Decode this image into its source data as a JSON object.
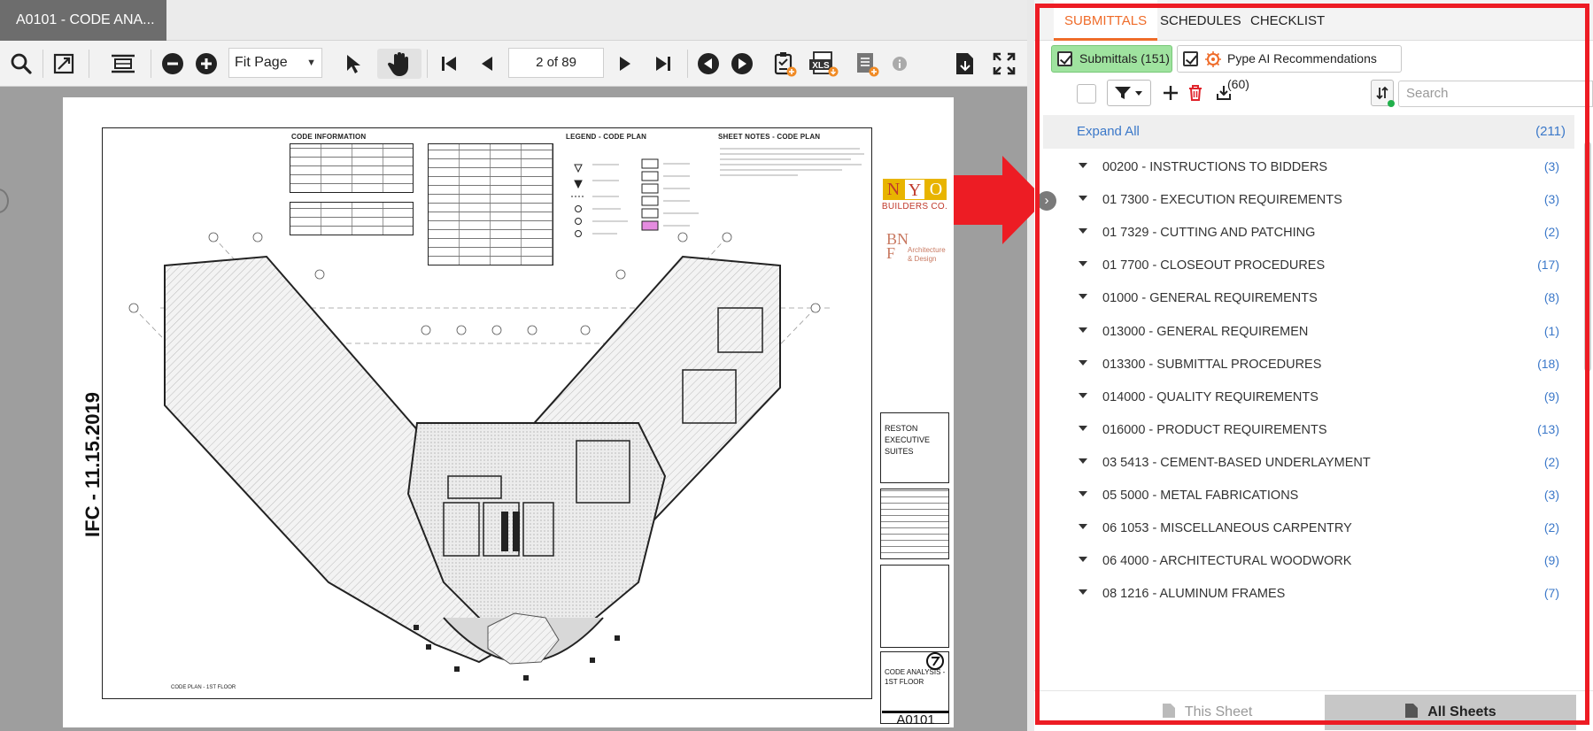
{
  "document": {
    "tab_title": "A0101 - CODE ANA..."
  },
  "toolbar": {
    "zoom_value": "Fit Page",
    "page_indicator": "2 of 89",
    "icons": [
      "search-icon",
      "fit-width-icon",
      "fit-page-icon",
      "zoom-out-icon",
      "zoom-in-icon",
      "select-pointer-icon",
      "pan-hand-icon",
      "first-page-icon",
      "previous-page-icon",
      "next-page-icon",
      "last-page-icon",
      "back-icon",
      "forward-icon",
      "clipboard-check-icon",
      "xls-export-icon",
      "document-add-icon",
      "info-icon",
      "export-icon",
      "fullscreen-icon"
    ]
  },
  "sheet": {
    "code_information": "CODE INFORMATION",
    "legend": "LEGEND - CODE PLAN",
    "sheet_notes": "SHEET NOTES - CODE PLAN",
    "stamp": "IFC - 11.15.2019",
    "logo_letters": [
      "N",
      "Y",
      "O"
    ],
    "logo_colors": [
      "#e8b400",
      "#c0392b",
      "#e8b400"
    ],
    "logo_subtitle": "BUILDERS CO.",
    "bnf_letters": "BN\nF",
    "bnf_sub": "Architecture\n& Design",
    "project_name": "RESTON\nEXECUTIVE\nSUITES",
    "sheet_title": "CODE ANALYSIS -\n1ST FLOOR",
    "sheet_number": "A0101",
    "plan_caption": "CODE PLAN - 1ST FLOOR"
  },
  "panel": {
    "tabs": [
      {
        "label": "SUBMITTALS",
        "active": true
      },
      {
        "label": "SCHEDULES",
        "active": false
      },
      {
        "label": "CHECKLIST",
        "active": false
      }
    ],
    "filters": [
      {
        "label": "Submittals (151)",
        "checked": true
      },
      {
        "label": "Pype AI Recommendations (60)",
        "checked": true
      }
    ],
    "search_placeholder": "Search",
    "expand_all": "Expand All",
    "total_count": "(211)",
    "sections": [
      {
        "label": "00200 - INSTRUCTIONS TO BIDDERS",
        "count": "(3)"
      },
      {
        "label": "01 7300 - EXECUTION REQUIREMENTS",
        "count": "(3)"
      },
      {
        "label": "01 7329 - CUTTING AND PATCHING",
        "count": "(2)"
      },
      {
        "label": "01 7700 - CLOSEOUT PROCEDURES",
        "count": "(17)"
      },
      {
        "label": "01000 - GENERAL REQUIREMENTS",
        "count": "(8)"
      },
      {
        "label": "013000 - GENERAL REQUIREMEN",
        "count": "(1)"
      },
      {
        "label": "013300 - SUBMITTAL PROCEDURES",
        "count": "(18)"
      },
      {
        "label": "014000 - QUALITY REQUIREMENTS",
        "count": "(9)"
      },
      {
        "label": "016000 - PRODUCT REQUIREMENTS",
        "count": "(13)"
      },
      {
        "label": "03 5413 - CEMENT-BASED UNDERLAYMENT",
        "count": "(2)"
      },
      {
        "label": "05 5000 - METAL FABRICATIONS",
        "count": "(3)"
      },
      {
        "label": "06 1053 - MISCELLANEOUS CARPENTRY",
        "count": "(2)"
      },
      {
        "label": "06 4000 - ARCHITECTURAL WOODWORK",
        "count": "(9)"
      },
      {
        "label": "08 1216 - ALUMINUM FRAMES",
        "count": "(7)"
      }
    ],
    "footer": {
      "this_sheet": "This Sheet",
      "all_sheets": "All Sheets"
    }
  },
  "colors": {
    "accent_orange": "#ef6c2a",
    "link_blue": "#3b78c9",
    "highlight_red": "#ed1c24",
    "chip_green": "#9fe39f"
  }
}
